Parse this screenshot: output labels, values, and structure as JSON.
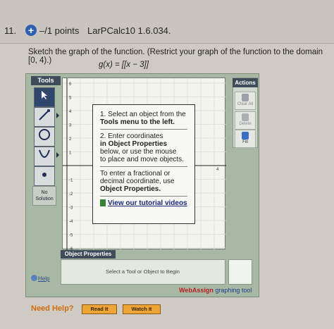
{
  "question": {
    "number": "11.",
    "points": "–/1 points",
    "id": "LarPCalc10 1.6.034.",
    "prompt": "Sketch the graph of the function. (Restrict your graph of the function to the domain [0, 4).)",
    "function": "g(x) = [[x − 3]]"
  },
  "tools": {
    "title": "Tools",
    "no_solution": "No Solution"
  },
  "graph": {
    "y_ticks": [
      "6",
      "5",
      "4",
      "3",
      "2",
      "1",
      "-1",
      "-2",
      "-3",
      "-4",
      "-5",
      "-6"
    ],
    "x_ticks": [
      "4"
    ]
  },
  "actions": {
    "title": "Actions",
    "clear_all": "Clear All",
    "delete": "Delete",
    "fill": "Fill"
  },
  "popup": {
    "step1": "1. Select an object from the",
    "step1b": "Tools menu to the left.",
    "step2": "2. Enter coordinates",
    "step2b": "in Object Properties",
    "step2c": "below, or use the mouse",
    "step2d": "to place and move objects.",
    "step3": "To enter a fractional or",
    "step3b": "decimal coordinate, use",
    "step3c": "Object Properties.",
    "tutorial": "View our tutorial videos"
  },
  "object_properties": {
    "title": "Object Properties",
    "message": "Select a Tool or Object to Begin"
  },
  "help_label": "Help",
  "webassign": {
    "brand": "WebAssign",
    "suffix": " graphing tool"
  },
  "need_help": "Need Help?",
  "read_it": "Read It",
  "watch_it": "Watch It"
}
